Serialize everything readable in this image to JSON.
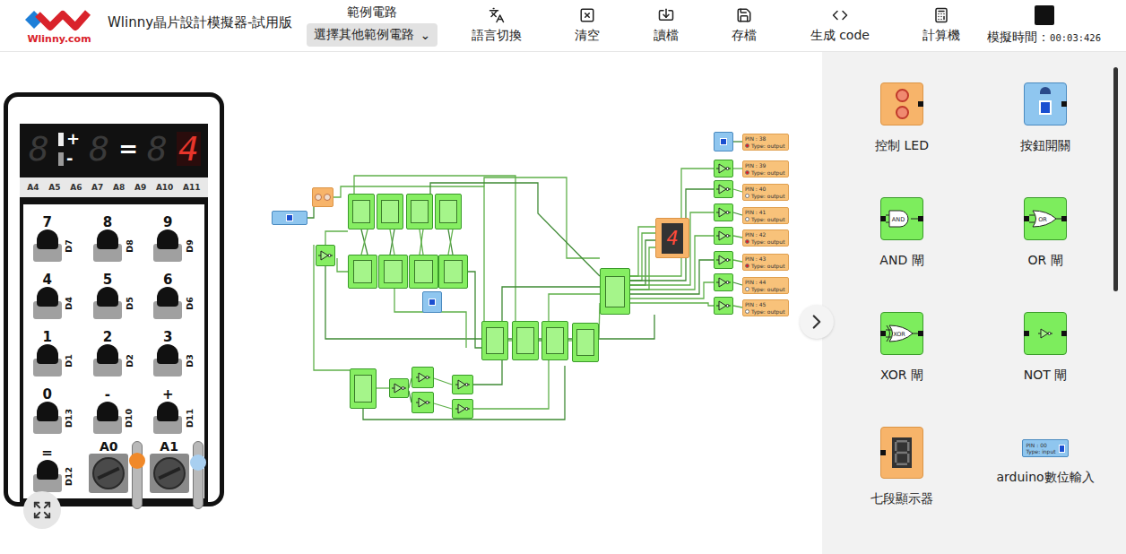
{
  "header": {
    "logo_text": "Wlinny.com",
    "title": "Wlinny晶片設計模擬器-試用版",
    "example": {
      "label": "範例電路",
      "value": "選擇其他範例電路",
      "caret": "⌄"
    },
    "tools": [
      {
        "label": "語言切換",
        "kind": "language"
      },
      {
        "label": "清空",
        "kind": "clear"
      },
      {
        "label": "讀檔",
        "kind": "load"
      },
      {
        "label": "存檔",
        "kind": "save"
      },
      {
        "label": "生成 code",
        "kind": "code"
      },
      {
        "label": "計算機",
        "kind": "calculator"
      }
    ],
    "sim_time": {
      "label": "模擬時間：",
      "value": "00:03:426",
      "running": true
    }
  },
  "calculator": {
    "display": {
      "left": {
        "value": "8",
        "lit": false
      },
      "ops": [
        {
          "label": "+",
          "selected": true
        },
        {
          "label": "-",
          "selected": false
        }
      ],
      "right": {
        "value": "8",
        "lit": false
      },
      "equals": "=",
      "result": [
        {
          "value": "8",
          "lit": false
        },
        {
          "value": "4",
          "lit": true
        }
      ]
    },
    "analog_pins": [
      "A4",
      "A5",
      "A6",
      "A7",
      "A8",
      "A9",
      "A10",
      "A11"
    ],
    "keys": [
      {
        "label": "7",
        "pin": "D7"
      },
      {
        "label": "8",
        "pin": "D8"
      },
      {
        "label": "9",
        "pin": "D9"
      },
      {
        "label": "4",
        "pin": "D4"
      },
      {
        "label": "5",
        "pin": "D5"
      },
      {
        "label": "6",
        "pin": "D6"
      },
      {
        "label": "1",
        "pin": "D1"
      },
      {
        "label": "2",
        "pin": "D2"
      },
      {
        "label": "3",
        "pin": "D3"
      },
      {
        "label": "0",
        "pin": "D13"
      },
      {
        "label": "-",
        "pin": "D10"
      },
      {
        "label": "+",
        "pin": "D11"
      }
    ],
    "equals_key": {
      "label": "=",
      "pin": "D12"
    },
    "knobs": [
      {
        "label": "A0",
        "level": 0.8,
        "color": "#f0892a"
      },
      {
        "label": "A1",
        "level": 0.76,
        "color": "#a8cff0"
      }
    ]
  },
  "circuit": {
    "display": {
      "value": "4",
      "lit": true
    },
    "pins": [
      {
        "pin": "PIN : 38",
        "type": "Type: output",
        "on": true
      },
      {
        "pin": "PIN : 39",
        "type": "Type: output",
        "on": true
      },
      {
        "pin": "PIN : 40",
        "type": "Type: output",
        "on": false
      },
      {
        "pin": "PIN : 41",
        "type": "Type: output",
        "on": false
      },
      {
        "pin": "PIN : 42",
        "type": "Type: output",
        "on": true
      },
      {
        "pin": "PIN : 43",
        "type": "Type: output",
        "on": true
      },
      {
        "pin": "PIN : 44",
        "type": "Type: output",
        "on": false
      },
      {
        "pin": "PIN : 45",
        "type": "Type: output",
        "on": false
      }
    ]
  },
  "palette": {
    "items": [
      {
        "label": "控制 LED",
        "kind": "led"
      },
      {
        "label": "按鈕開關",
        "kind": "button"
      },
      {
        "label": "AND 閘",
        "kind": "gate",
        "gate": "AND"
      },
      {
        "label": "OR 閘",
        "kind": "gate",
        "gate": "OR"
      },
      {
        "label": "XOR 閘",
        "kind": "gate",
        "gate": "XOR"
      },
      {
        "label": "NOT 閘",
        "kind": "not"
      },
      {
        "label": "七段顯示器",
        "kind": "seven"
      },
      {
        "label": "arduino數位輸入",
        "kind": "input",
        "pin": "PIN : 00",
        "type": "Type: input"
      }
    ]
  }
}
